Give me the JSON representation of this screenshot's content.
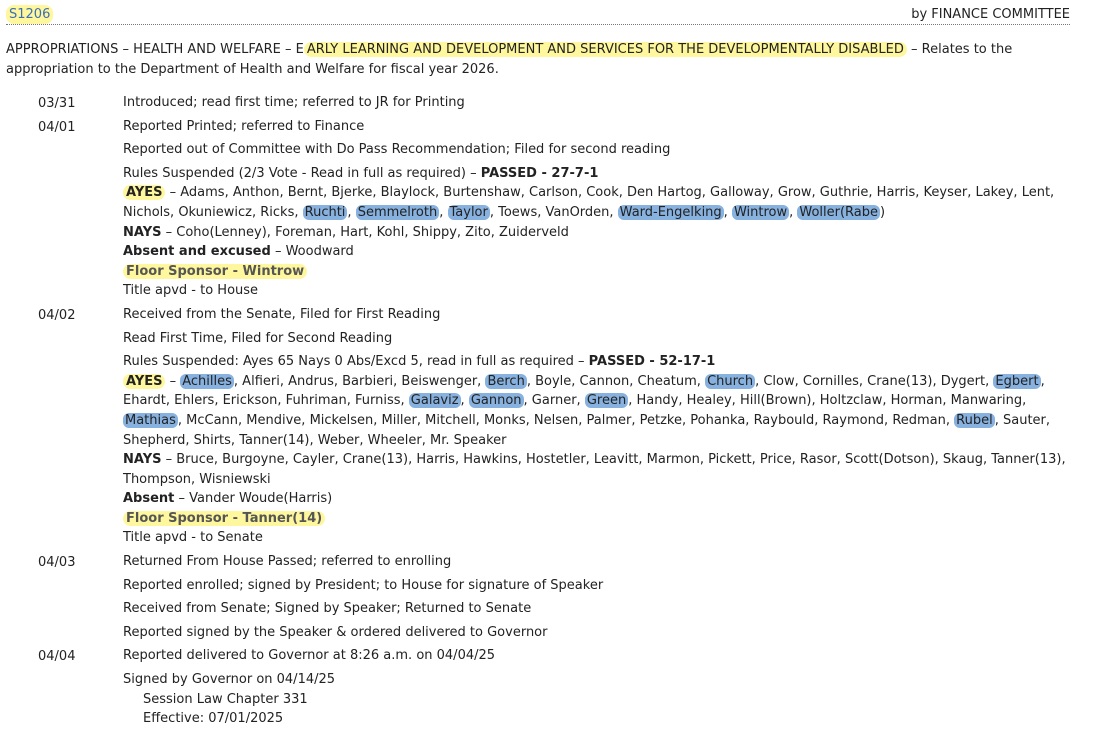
{
  "bill": {
    "number": "S1206",
    "sponsor": "by FINANCE COMMITTEE",
    "summary_pre": "APPROPRIATIONS – HEALTH AND WELFARE – E",
    "summary_hl": "ARLY LEARNING AND DEVELOPMENT AND SERVICES FOR THE DEVELOPMENTALLY DISABLED",
    "summary_post": " – Relates to the appropriation to the Department of Health and Welfare for fiscal year 2026."
  },
  "history": {
    "d0331": {
      "date": "03/31",
      "a1": "Introduced; read first time; referred to JR for Printing"
    },
    "d0401": {
      "date": "04/01",
      "a1": "Reported Printed; referred to Finance",
      "a2": "Reported out of Committee with Do Pass Recommendation; Filed for second reading",
      "a3": "Rules Suspended (2/3 Vote - Read in full as required) – ",
      "a3_result": "PASSED - 27-7-1",
      "ayes_label": "AYES",
      "ayes_p1": " – Adams, Anthon, Bernt, Bjerke, Blaylock, Burtenshaw, Carlson, Cook, Den Hartog, Galloway, Grow, Guthrie, Harris, Keyser, Lakey, Lent, Nichols, Okuniewicz, Ricks, ",
      "ayes_h1": "Ruchti",
      "ayes_s1": ", ",
      "ayes_h2": "Semmelroth",
      "ayes_s2": ", ",
      "ayes_h3": "Taylor",
      "ayes_s3": ", Toews, VanOrden, ",
      "ayes_h4": "Ward-Engelking",
      "ayes_s4": ", ",
      "ayes_h5": "Wintrow",
      "ayes_s5": ", ",
      "ayes_h6": "Woller(Rabe",
      "ayes_end": ")",
      "nays_label": "NAYS",
      "nays": " – Coho(Lenney), Foreman, Hart, Kohl, Shippy, Zito, Zuiderveld",
      "absent_label": "Absent and excused",
      "absent": " – Woodward",
      "floor": "Floor Sponsor - Wintrow",
      "title": "Title apvd - to House"
    },
    "d0402": {
      "date": "04/02",
      "a1": "Received from the Senate, Filed for First Reading",
      "a2": "Read First Time, Filed for Second Reading",
      "a3": "Rules Suspended: Ayes 65 Nays 0 Abs/Excd 5, read in full as required – ",
      "a3_result": "PASSED - 52-17-1",
      "ayes_label": "AYES",
      "ayes_s0": " – ",
      "ayes_h1": "Achilles",
      "ayes_s1": ", Alfieri, Andrus, Barbieri, Beiswenger, ",
      "ayes_h2": "Berch",
      "ayes_s2": ", Boyle, Cannon, Cheatum, ",
      "ayes_h3": "Church",
      "ayes_s3": ", Clow, Cornilles, Crane(13), Dygert, ",
      "ayes_h4": "Egbert",
      "ayes_s4": ", Ehardt, Ehlers, Erickson, Fuhriman, Furniss, ",
      "ayes_h5": "Galaviz",
      "ayes_s5": ", ",
      "ayes_h6": "Gannon",
      "ayes_s6": ", Garner, ",
      "ayes_h7": "Green",
      "ayes_s7": ", Handy, Healey, Hill(Brown), Holtzclaw, Horman, Manwaring, ",
      "ayes_h8": "Mathias",
      "ayes_s8": ", McCann, Mendive, Mickelsen, Miller, Mitchell, Monks, Nelsen, Palmer, Petzke, Pohanka, Raybould, Raymond, Redman, ",
      "ayes_h9": "Rubel",
      "ayes_s9": ", Sauter, Shepherd, Shirts, Tanner(14), Weber, Wheeler, Mr. Speaker",
      "nays_label": "NAYS",
      "nays": " – Bruce, Burgoyne, Cayler, Crane(13), Harris, Hawkins, Hostetler, Leavitt, Marmon, Pickett, Price, Rasor, Scott(Dotson), Skaug, Tanner(13), Thompson, Wisniewski",
      "absent_label": "Absent",
      "absent": " – Vander Woude(Harris)",
      "floor": "Floor Sponsor - Tanner(14)",
      "title": "Title apvd - to Senate"
    },
    "d0403": {
      "date": "04/03",
      "a1": "Returned From House Passed; referred to enrolling",
      "a2": "Reported enrolled; signed by President; to House for signature of Speaker",
      "a3": "Received from Senate; Signed by Speaker; Returned to Senate",
      "a4": "Reported signed by the Speaker & ordered delivered to Governor"
    },
    "d0404": {
      "date": "04/04",
      "a1": "Reported delivered to Governor at 8:26 a.m. on 04/04/25",
      "a2": "Signed by Governor on 04/14/25",
      "a3": "Session Law Chapter 331",
      "a4": "Effective: 07/01/2025"
    }
  }
}
